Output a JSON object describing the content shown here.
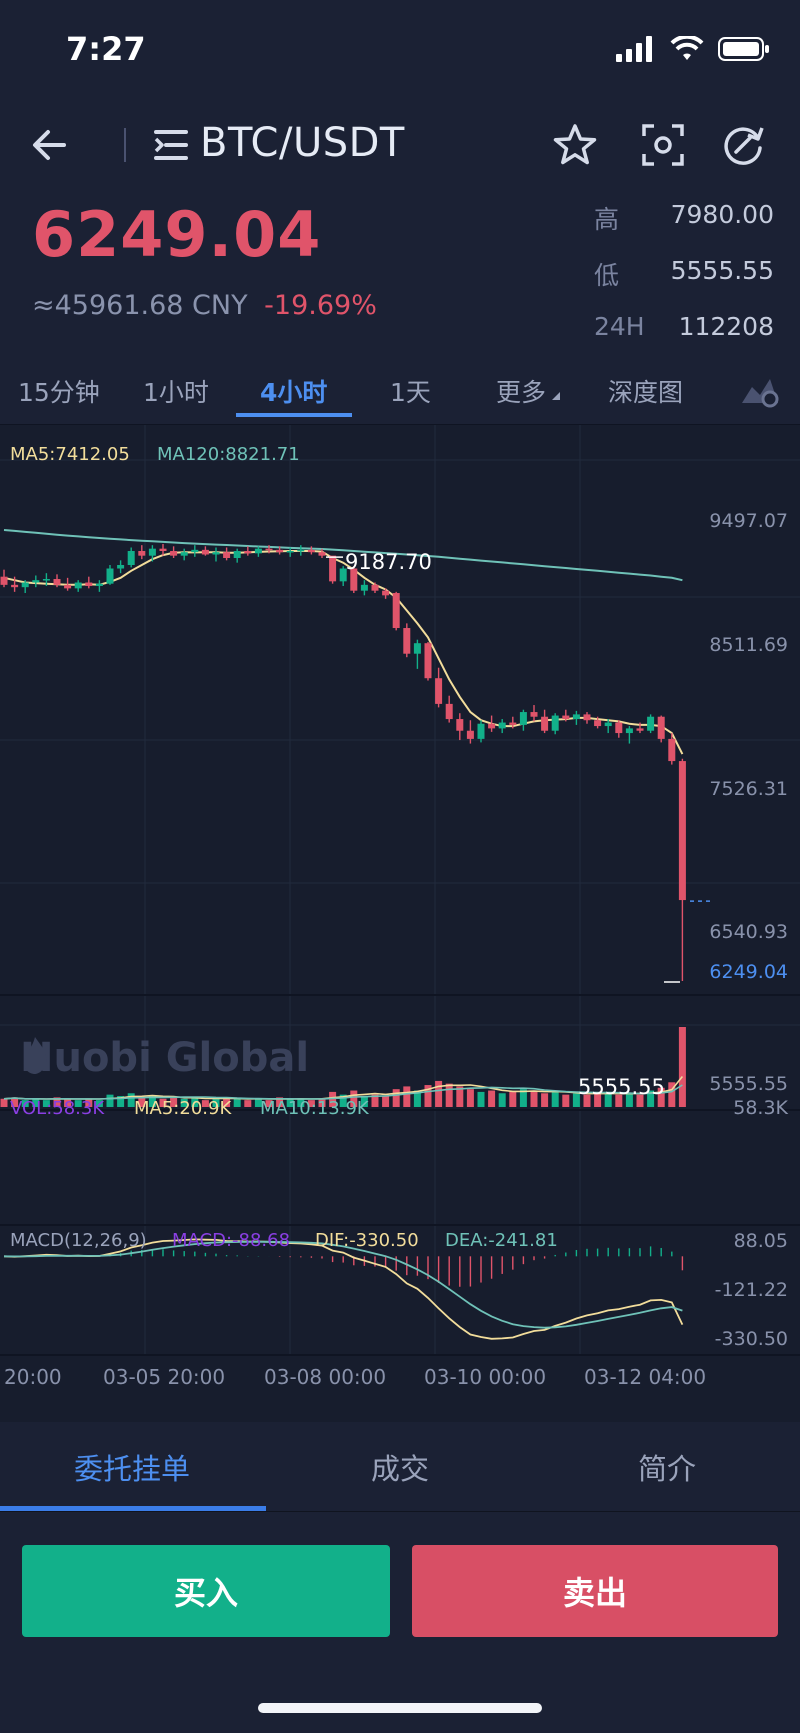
{
  "status_bar": {
    "time": "7:27",
    "icons": [
      "signal-icon",
      "wifi-icon",
      "battery-icon"
    ]
  },
  "nav": {
    "title": "BTC/USDT",
    "icons": [
      "back-arrow-icon",
      "list-menu-icon",
      "star-icon",
      "scan-icon",
      "refresh-icon"
    ]
  },
  "ticker": {
    "last_price": "6249.04",
    "cny_value": "≈45961.68 CNY",
    "change_pct": "-19.69%",
    "high_label": "高",
    "high_value": "7980.00",
    "low_label": "低",
    "low_value": "5555.55",
    "volume_label": "24H",
    "volume_value": "112208"
  },
  "timeframe_tabs": [
    {
      "label": "15分钟",
      "active": false
    },
    {
      "label": "1小时",
      "active": false
    },
    {
      "label": "4小时",
      "active": true
    },
    {
      "label": "1天",
      "active": false
    },
    {
      "label": "更多",
      "active": false
    },
    {
      "label": "深度图",
      "active": false
    }
  ],
  "colors": {
    "up": "#12b08a",
    "down": "#e0546a",
    "accent": "#4d8ff0",
    "ma5": "#f2dd9b",
    "ma120": "#6fc2b8",
    "volume_legend": "#8a3fe3",
    "macd_legend": "#8a3fe3"
  },
  "chart_legends": {
    "ma5": "MA5:7412.05",
    "ma120": "MA120:8821.71",
    "vol": "VOL:58.3K",
    "vol_ma5": "MA5:20.9K",
    "vol_ma10": "MA10:13.9K",
    "macd_params": "MACD(12,26,9)",
    "macd": "MACD:-88.68",
    "dif": "DIF:-330.50",
    "dea": "DEA:-241.81"
  },
  "watermark": "Huobi Global",
  "chart_data": {
    "type": "candlestick",
    "price_axis": {
      "ticks": [
        "9497.07",
        "8511.69",
        "7526.31",
        "6540.93",
        "5555.55"
      ],
      "min": 5555.55,
      "max": 9497.07
    },
    "current_price_label": "6249.04",
    "annotations": {
      "high": "9187.70",
      "low": "5555.55"
    },
    "volume_axis": {
      "max_label": "58.3K"
    },
    "macd_axis": {
      "ticks": [
        "88.05",
        "-121.22",
        "-330.50"
      ]
    },
    "x_ticks": [
      "20:00",
      "03-05 20:00",
      "03-08 00:00",
      "03-10 00:00",
      "03-12 04:00"
    ],
    "candles": [
      [
        9020,
        9080,
        8930,
        8950
      ],
      [
        8950,
        9020,
        8890,
        8930
      ],
      [
        8930,
        8990,
        8880,
        8970
      ],
      [
        8970,
        9030,
        8930,
        8990
      ],
      [
        8990,
        9050,
        8940,
        9000
      ],
      [
        9000,
        9040,
        8930,
        8950
      ],
      [
        8950,
        9010,
        8900,
        8920
      ],
      [
        8920,
        8990,
        8890,
        8970
      ],
      [
        8970,
        9020,
        8920,
        8940
      ],
      [
        8940,
        8990,
        8890,
        8960
      ],
      [
        8960,
        9120,
        8950,
        9090
      ],
      [
        9090,
        9160,
        9050,
        9120
      ],
      [
        9120,
        9270,
        9100,
        9240
      ],
      [
        9240,
        9290,
        9170,
        9200
      ],
      [
        9200,
        9290,
        9150,
        9260
      ],
      [
        9260,
        9300,
        9200,
        9240
      ],
      [
        9240,
        9280,
        9180,
        9200
      ],
      [
        9200,
        9260,
        9160,
        9230
      ],
      [
        9230,
        9290,
        9190,
        9250
      ],
      [
        9250,
        9280,
        9200,
        9210
      ],
      [
        9210,
        9270,
        9150,
        9230
      ],
      [
        9230,
        9270,
        9160,
        9180
      ],
      [
        9180,
        9260,
        9140,
        9240
      ],
      [
        9240,
        9280,
        9200,
        9220
      ],
      [
        9220,
        9280,
        9190,
        9260
      ],
      [
        9260,
        9290,
        9220,
        9250
      ],
      [
        9250,
        9280,
        9210,
        9230
      ],
      [
        9230,
        9270,
        9190,
        9240
      ],
      [
        9240,
        9290,
        9200,
        9250
      ],
      [
        9250,
        9280,
        9210,
        9230
      ],
      [
        9230,
        9260,
        9180,
        9200
      ],
      [
        9200,
        9190,
        8960,
        8980
      ],
      [
        8980,
        9110,
        8940,
        9090
      ],
      [
        9090,
        9110,
        8880,
        8900
      ],
      [
        8900,
        8990,
        8860,
        8950
      ],
      [
        8950,
        8970,
        8880,
        8900
      ],
      [
        8900,
        8920,
        8830,
        8860
      ],
      [
        8880,
        8890,
        8560,
        8580
      ],
      [
        8580,
        8620,
        8330,
        8360
      ],
      [
        8360,
        8480,
        8230,
        8450
      ],
      [
        8450,
        8460,
        8130,
        8150
      ],
      [
        8150,
        8240,
        7900,
        7930
      ],
      [
        7930,
        8000,
        7770,
        7800
      ],
      [
        7800,
        7850,
        7620,
        7700
      ],
      [
        7700,
        7790,
        7590,
        7630
      ],
      [
        7630,
        7790,
        7600,
        7760
      ],
      [
        7760,
        7830,
        7690,
        7720
      ],
      [
        7720,
        7800,
        7680,
        7770
      ],
      [
        7770,
        7820,
        7720,
        7750
      ],
      [
        7750,
        7880,
        7700,
        7860
      ],
      [
        7860,
        7920,
        7780,
        7820
      ],
      [
        7820,
        7880,
        7680,
        7700
      ],
      [
        7700,
        7850,
        7670,
        7830
      ],
      [
        7830,
        7880,
        7780,
        7800
      ],
      [
        7800,
        7870,
        7750,
        7840
      ],
      [
        7840,
        7860,
        7760,
        7790
      ],
      [
        7790,
        7820,
        7720,
        7740
      ],
      [
        7740,
        7800,
        7680,
        7770
      ],
      [
        7770,
        7790,
        7640,
        7680
      ],
      [
        7680,
        7740,
        7590,
        7720
      ],
      [
        7720,
        7770,
        7680,
        7700
      ],
      [
        7700,
        7840,
        7680,
        7820
      ],
      [
        7820,
        7830,
        7600,
        7630
      ],
      [
        7630,
        7680,
        7410,
        7440
      ],
      [
        7440,
        7460,
        5555.55,
        6249.04
      ]
    ],
    "ma5": [
      9010,
      8990,
      8970,
      8965,
      8960,
      8955,
      8950,
      8950,
      8955,
      8950,
      8975,
      9010,
      9070,
      9120,
      9170,
      9205,
      9225,
      9230,
      9228,
      9230,
      9230,
      9225,
      9225,
      9228,
      9232,
      9236,
      9238,
      9240,
      9240,
      9240,
      9235,
      9180,
      9140,
      9080,
      9010,
      8950,
      8910,
      8840,
      8730,
      8620,
      8500,
      8320,
      8140,
      7990,
      7860,
      7790,
      7760,
      7740,
      7740,
      7760,
      7780,
      7790,
      7795,
      7800,
      7810,
      7810,
      7800,
      7790,
      7780,
      7760,
      7750,
      7750,
      7740,
      7680,
      7500
    ],
    "ma120": [
      9420,
      9412,
      9404,
      9396,
      9388,
      9380,
      9372,
      9365,
      9358,
      9351,
      9345,
      9339,
      9333,
      9328,
      9323,
      9318,
      9313,
      9308,
      9303,
      9299,
      9295,
      9291,
      9287,
      9283,
      9279,
      9275,
      9271,
      9267,
      9264,
      9261,
      9257,
      9252,
      9246,
      9240,
      9234,
      9228,
      9222,
      9216,
      9210,
      9204,
      9197,
      9190,
      9182,
      9174,
      9166,
      9158,
      9150,
      9142,
      9134,
      9126,
      9118,
      9110,
      9102,
      9094,
      9086,
      9078,
      9070,
      9062,
      9054,
      9046,
      9038,
      9030,
      9020,
      9010,
      8990
    ],
    "volume": [
      6,
      7,
      5,
      6,
      5,
      7,
      6,
      5,
      6,
      5,
      9,
      8,
      10,
      7,
      8,
      6,
      7,
      6,
      7,
      5,
      6,
      7,
      6,
      5,
      6,
      5,
      7,
      6,
      6,
      5,
      6,
      11,
      9,
      12,
      8,
      9,
      8,
      13,
      15,
      12,
      16,
      19,
      17,
      15,
      13,
      11,
      12,
      10,
      11,
      13,
      12,
      10,
      11,
      9,
      10,
      9,
      10,
      11,
      9,
      10,
      9,
      12,
      14,
      18,
      58.3
    ]
  },
  "bottom_tabs": [
    {
      "label": "委托挂单",
      "active": true
    },
    {
      "label": "成交",
      "active": false
    },
    {
      "label": "简介",
      "active": false
    }
  ],
  "actions": {
    "buy_label": "买入",
    "sell_label": "卖出"
  }
}
